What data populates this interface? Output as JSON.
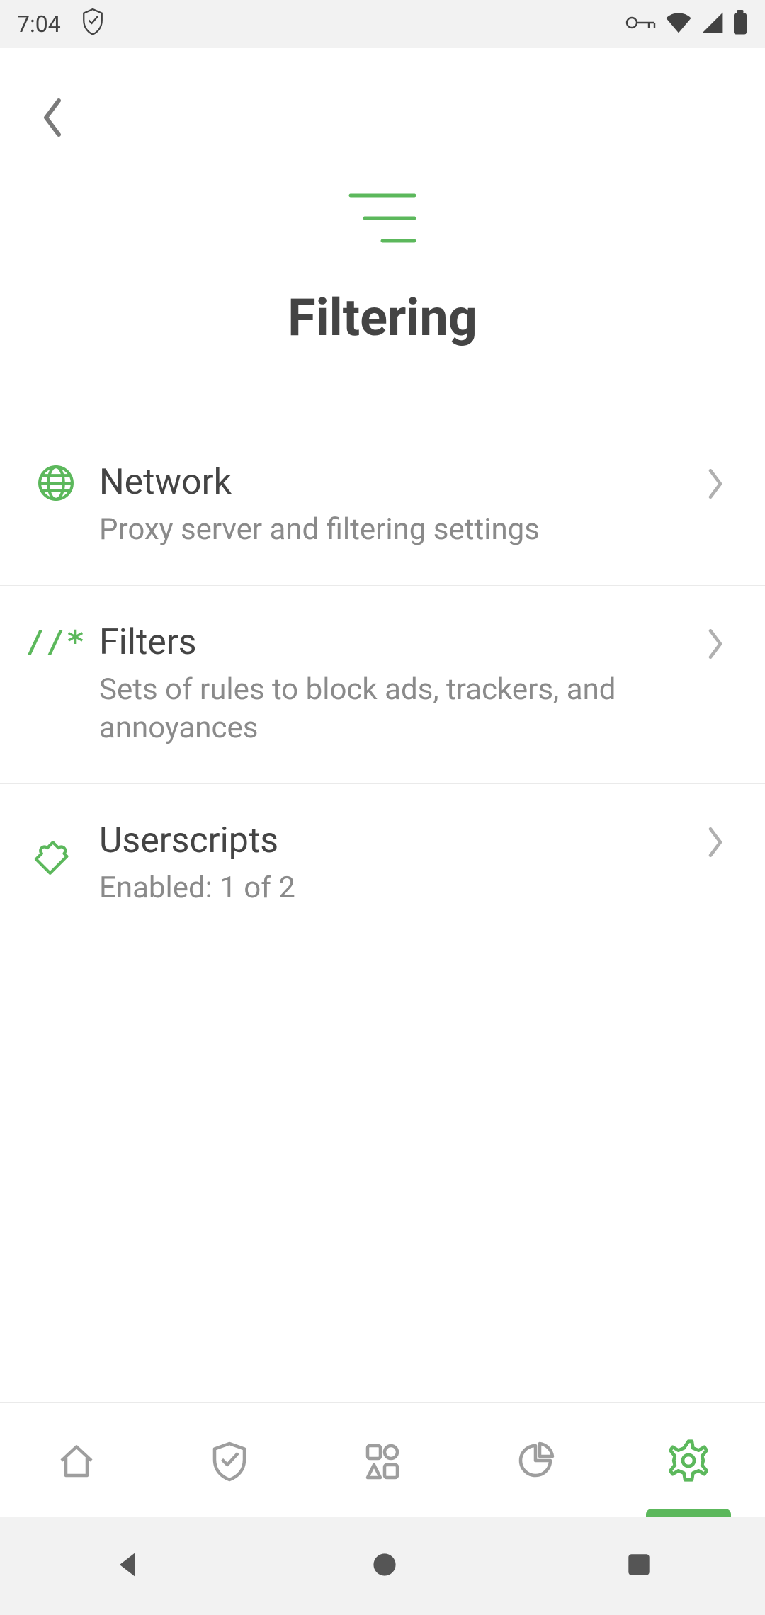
{
  "status": {
    "time": "7:04"
  },
  "header": {
    "title": "Filtering"
  },
  "rows": {
    "network": {
      "title": "Network",
      "subtitle": "Proxy server and filtering settings"
    },
    "filters": {
      "title": "Filters",
      "subtitle": "Sets of rules to block ads, trackers, and annoyances"
    },
    "userscripts": {
      "title": "Userscripts",
      "subtitle": "Enabled: 1 of 2"
    }
  },
  "colors": {
    "accent": "#5CB85C",
    "textPrimary": "#444444",
    "textSecondary": "#8A8A8A",
    "chevron": "#B0B0B0"
  }
}
